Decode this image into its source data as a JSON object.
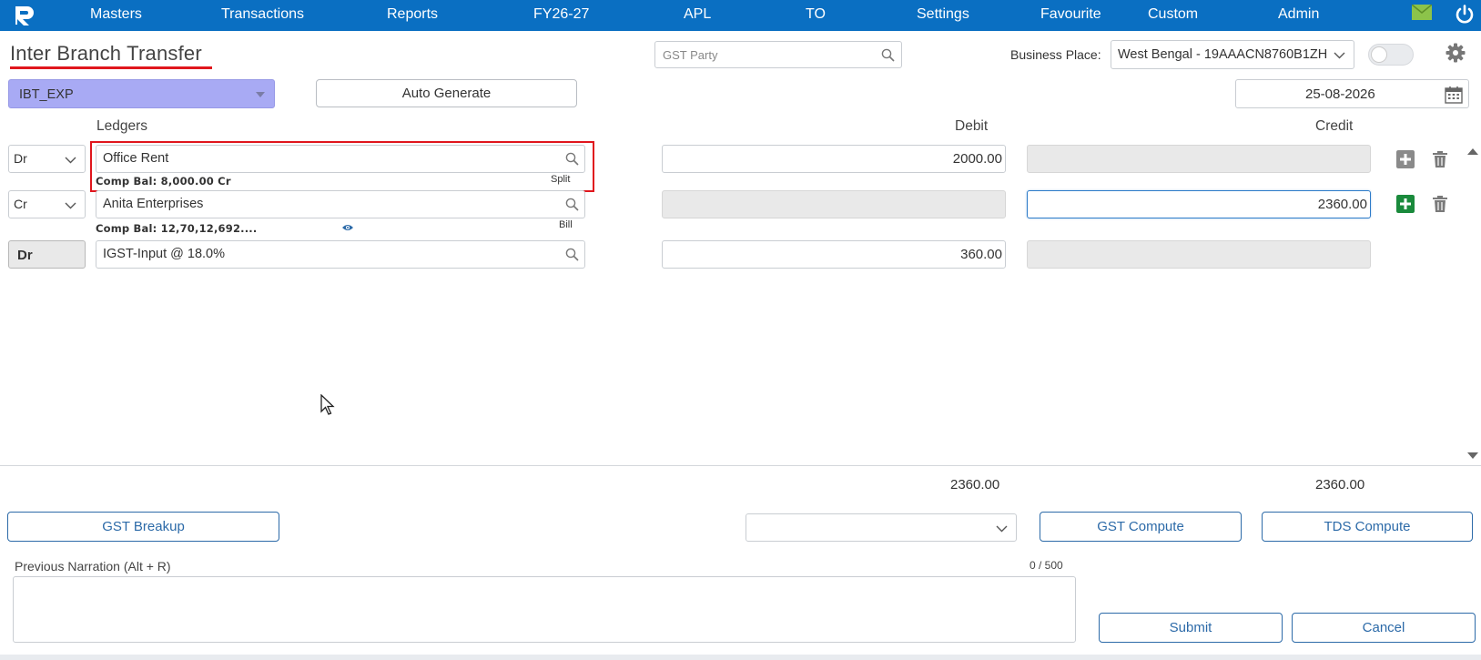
{
  "nav": {
    "items": [
      "Masters",
      "Transactions",
      "Reports",
      "FY26-27",
      "APL",
      "TO",
      "Settings",
      "Favourite",
      "Custom",
      "Admin"
    ]
  },
  "icons": {
    "logo": "logo-icon",
    "mail": "mail-icon",
    "power": "power-icon",
    "search": "search-icon",
    "gear": "gear-icon",
    "calendar": "calendar-icon",
    "plus": "plus-icon",
    "trash": "trash-icon",
    "eye": "eye-icon"
  },
  "colors": {
    "nav_bg": "#0a6fc2",
    "title_underline": "#e0161d",
    "voucher_type_bg": "#a8aaf4",
    "add_active": "#1a8a3c",
    "button_text": "#2c6aa8"
  },
  "header": {
    "page_title": "Inter Branch Transfer",
    "gst_party_placeholder": "GST Party",
    "business_place_label": "Business Place:",
    "business_place_value": "West Bengal - 19AAACN8760B1ZH",
    "voucher_type": "IBT_EXP",
    "auto_generate_label": "Auto Generate",
    "date": "25-08-2026"
  },
  "columns": {
    "ledgers": "Ledgers",
    "debit": "Debit",
    "credit": "Credit"
  },
  "rows": [
    {
      "drcr": "Dr",
      "ledger": "Office Rent",
      "balance": "Comp Bal: 8,000.00 Cr",
      "link": "Split",
      "debit": "2000.00",
      "credit": ""
    },
    {
      "drcr": "Cr",
      "ledger": "Anita Enterprises",
      "balance": "Comp Bal: 12,70,12,692....",
      "link": "Bill",
      "debit": "",
      "credit": "2360.00"
    },
    {
      "drcr": "Dr",
      "ledger": "IGST-Input @ 18.0%",
      "balance": "",
      "link": "",
      "debit": "360.00",
      "credit": ""
    }
  ],
  "totals": {
    "debit": "2360.00",
    "credit": "2360.00"
  },
  "footer": {
    "gst_breakup": "GST Breakup",
    "gst_compute": "GST Compute",
    "tds_compute": "TDS Compute",
    "narration_label": "Previous Narration (Alt + R)",
    "narration_count": "0 / 500",
    "submit": "Submit",
    "cancel": "Cancel"
  }
}
